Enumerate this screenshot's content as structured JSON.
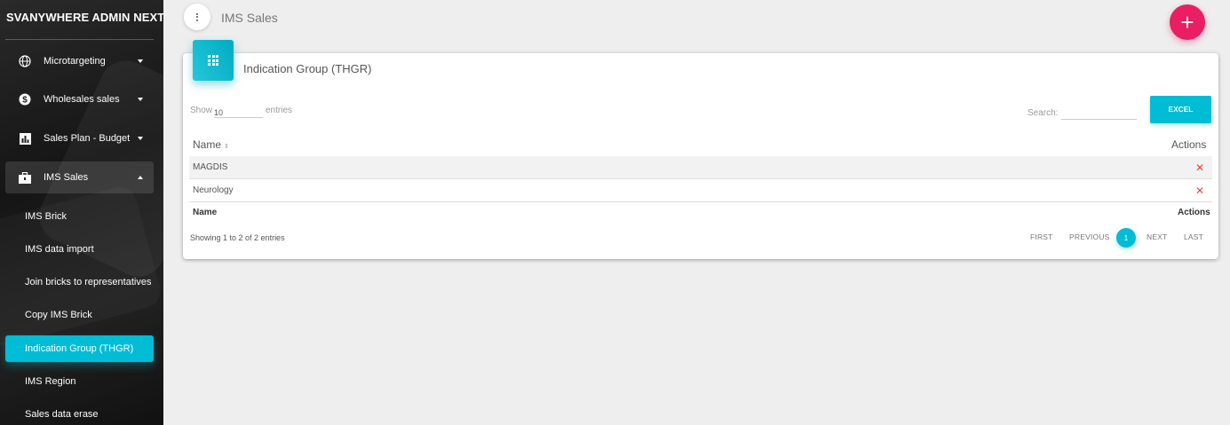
{
  "sidebar": {
    "brand": "SVANYWHERE ADMIN NEXT",
    "items": [
      {
        "label": "Microtargeting",
        "icon": "globe-icon",
        "expanded": false
      },
      {
        "label": "Wholesales sales",
        "icon": "dollar-icon",
        "expanded": false
      },
      {
        "label": "Sales Plan - Budget",
        "icon": "bar-chart-icon",
        "expanded": false
      },
      {
        "label": "IMS Sales",
        "icon": "briefcase-icon",
        "expanded": true
      }
    ],
    "sub_items": [
      {
        "label": "IMS Brick",
        "active": false
      },
      {
        "label": "IMS data import",
        "active": false
      },
      {
        "label": "Join bricks to representatives",
        "active": false
      },
      {
        "label": "Copy IMS Brick",
        "active": false
      },
      {
        "label": "Indication Group (THGR)",
        "active": true
      },
      {
        "label": "IMS Region",
        "active": false
      },
      {
        "label": "Sales data erase",
        "active": false
      }
    ]
  },
  "header": {
    "title": "IMS Sales",
    "menu_icon": "more-vert-icon",
    "fab_label": "+"
  },
  "card": {
    "title": "Indication Group (THGR)",
    "icon": "grid-icon",
    "show_label": "Show",
    "show_value": "10",
    "entries_label": "entries",
    "search_label": "Search:",
    "search_value": "",
    "excel_label": "EXCEL",
    "columns": {
      "name": "Name",
      "actions": "Actions"
    },
    "sort_icon": "⇕",
    "rows": [
      {
        "name": "MAGDIS",
        "action": "✕"
      },
      {
        "name": "Neurology",
        "action": "✕"
      }
    ],
    "footer": {
      "name": "Name",
      "actions": "Actions"
    },
    "info": "Showing 1 to 2 of 2 entries",
    "pagination": {
      "first": "FIRST",
      "previous": "PREVIOUS",
      "current": "1",
      "next": "NEXT",
      "last": "LAST"
    }
  },
  "colors": {
    "accent": "#00bcd4",
    "fab": "#e91e63",
    "delete": "#f44336"
  }
}
